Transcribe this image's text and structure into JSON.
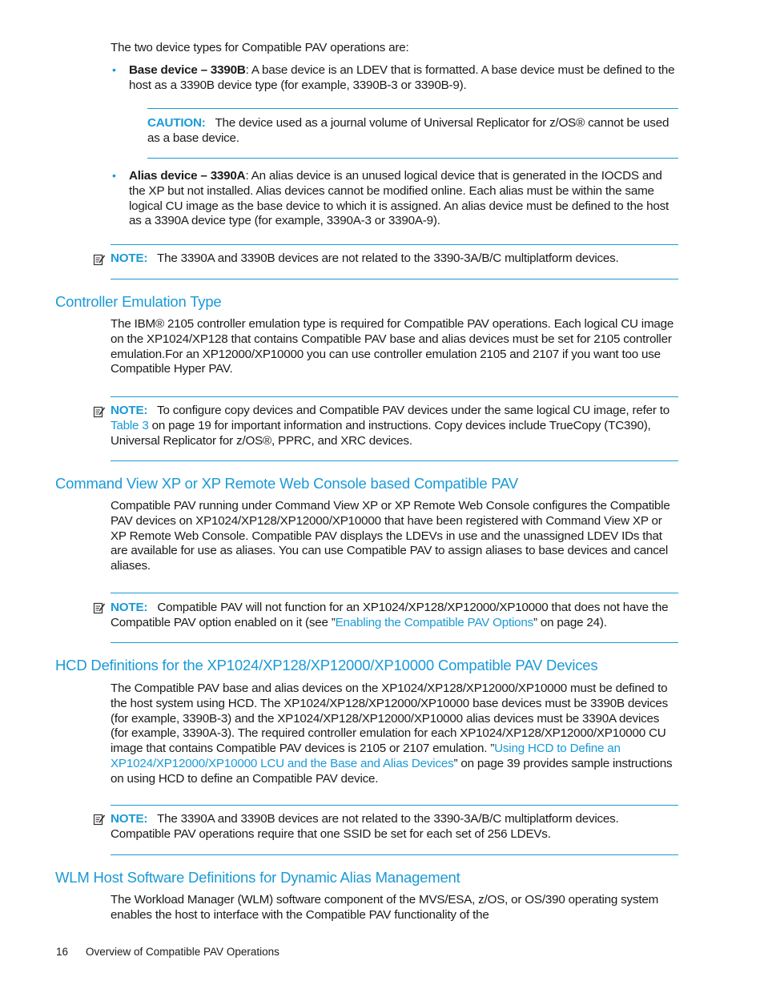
{
  "intro": "The two device types for Compatible PAV operations are:",
  "bullets": [
    {
      "term": "Base device – 3390B",
      "text": ": A base device is an LDEV that is formatted. A base device must be defined to the host as a 3390B device type (for example, 3390B-3 or 3390B-9)."
    },
    {
      "term": "Alias device – 3390A",
      "text": ": An alias device is an unused logical device that is generated in the IOCDS and the XP but not installed. Alias devices cannot be modified online. Each alias must be within the same logical CU image as the base device to which it is assigned. An alias device must be defined to the host as a 3390A device type (for example, 3390A-3 or 3390A-9)."
    }
  ],
  "caution": {
    "label": "CAUTION:",
    "text": "The device used as a journal volume of Universal Replicator for z/OS® cannot be used as a base device."
  },
  "note_label": "NOTE:",
  "notes": [
    {
      "text": "The 3390A and 3390B devices are not related to the 3390-3A/B/C multiplatform devices."
    },
    {
      "pre": "To configure copy devices and Compatible PAV devices under the same logical CU image, refer to ",
      "link": "Table 3",
      "post": " on page 19 for important information and instructions. Copy devices include TrueCopy (TC390), Universal Replicator for z/OS®, PPRC, and XRC devices."
    },
    {
      "pre": "Compatible PAV will not function for an XP1024/XP128/XP12000/XP10000 that does not have the Compatible PAV option enabled on it (see ”",
      "link": "Enabling the Compatible PAV Options",
      "post": "” on page 24)."
    },
    {
      "text": "The 3390A and 3390B devices are not related to the 3390-3A/B/C multiplatform devices. Compatible PAV operations require that one SSID be set for each set of 256 LDEVs."
    }
  ],
  "sections": [
    {
      "title": "Controller Emulation Type",
      "body": "The IBM® 2105 controller emulation type is required for Compatible PAV operations. Each logical CU image on the XP1024/XP128 that contains Compatible PAV base and alias devices must be set for 2105 controller emulation.For an XP12000/XP10000 you can use controller emulation 2105 and 2107 if you want too use Compatible Hyper PAV."
    },
    {
      "title": "Command View XP or XP Remote Web Console based Compatible PAV",
      "body": "Compatible PAV running under Command View XP or XP Remote Web Console configures the Compatible PAV devices on XP1024/XP128/XP12000/XP10000 that have been registered with Command View XP or XP Remote Web Console. Compatible PAV displays the LDEVs in use and the unassigned LDEV IDs that are available for use as aliases. You can use Compatible PAV to assign aliases to base devices and cancel aliases."
    },
    {
      "title": "HCD Definitions for the XP1024/XP128/XP12000/XP10000 Compatible PAV Devices",
      "pre": "The Compatible PAV base and alias devices on the XP1024/XP128/XP12000/XP10000 must be defined to the host system using HCD. The XP1024/XP128/XP12000/XP10000 base devices must be 3390B devices (for example, 3390B-3) and the XP1024/XP128/XP12000/XP10000 alias devices must be 3390A devices (for example, 3390A-3). The required controller emulation for each XP1024/XP128/XP12000/XP10000 CU image that contains Compatible PAV devices is 2105 or 2107 emulation. ”",
      "link": "Using HCD to Define an XP1024/XP12000/XP10000 LCU and the Base and Alias Devices",
      "post": "” on page 39 provides sample instructions on using HCD to define an Compatible PAV device."
    },
    {
      "title": "WLM Host Software Definitions for Dynamic Alias Management",
      "body": "The Workload Manager (WLM) software component of the MVS/ESA, z/OS, or OS/390 operating system enables the host to interface with the Compatible PAV functionality of the"
    }
  ],
  "footer": {
    "page_number": "16",
    "chapter": "Overview of Compatible PAV Operations"
  },
  "colors": {
    "accent": "#1a9ad6",
    "text": "#1a1a1a"
  }
}
